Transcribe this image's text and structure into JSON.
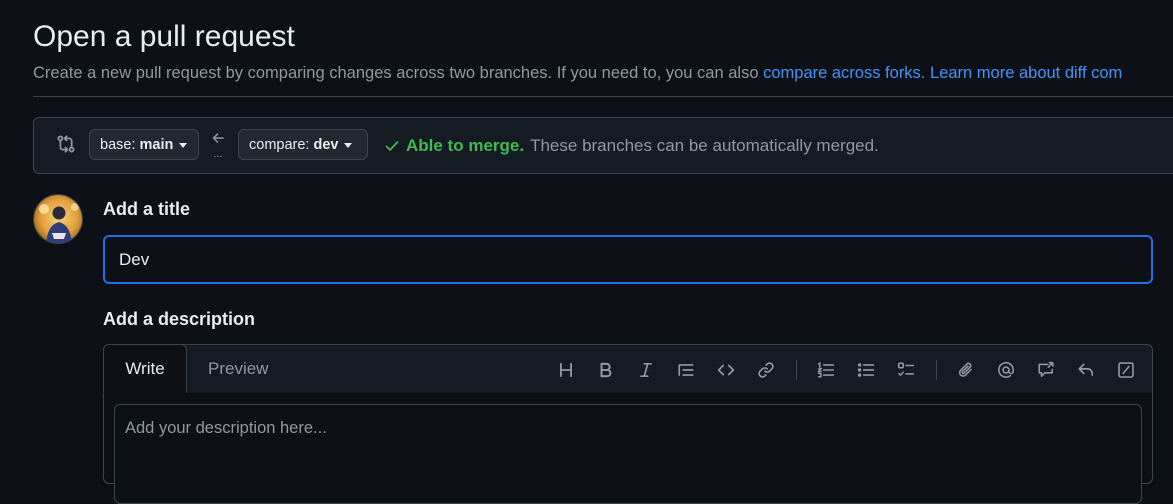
{
  "page": {
    "title": "Open a pull request",
    "subtitle_text": "Create a new pull request by comparing changes across two branches. If you need to, you can also ",
    "subtitle_link1": "compare across forks.",
    "subtitle_link2": "Learn more about diff com"
  },
  "compare": {
    "base_prefix": "base:",
    "base_branch": "main",
    "compare_prefix": "compare:",
    "compare_branch": "dev",
    "dots": "...",
    "merge_ok": "Able to merge.",
    "merge_text": "These branches can be automatically merged."
  },
  "form": {
    "title_label": "Add a title",
    "title_value": "Dev",
    "description_label": "Add a description",
    "description_placeholder": "Add your description here..."
  },
  "editor": {
    "tabs": [
      "Write",
      "Preview"
    ],
    "active_tab": "Write",
    "toolbar": [
      "heading-icon",
      "bold-icon",
      "italic-icon",
      "quote-icon",
      "code-icon",
      "link-icon",
      "ordered-list-icon",
      "unordered-list-icon",
      "task-list-icon",
      "attach-icon",
      "mention-icon",
      "cross-reference-icon",
      "reply-icon",
      "slash-command-icon"
    ]
  },
  "colors": {
    "background": "#0d1117",
    "accent_blue": "#4493f8",
    "focus_border": "#1f6feb",
    "success_green": "#3fb950",
    "muted_text": "#9198a1"
  }
}
